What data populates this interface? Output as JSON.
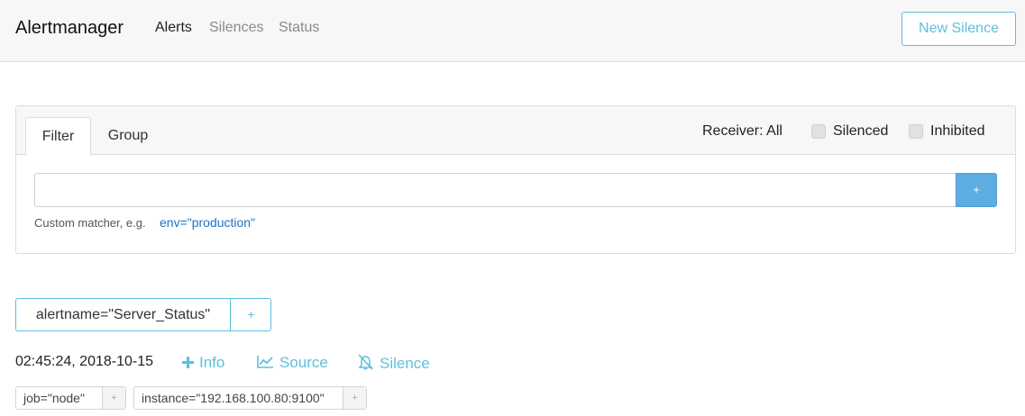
{
  "navbar": {
    "brand": "Alertmanager",
    "links": [
      {
        "label": "Alerts",
        "active": true
      },
      {
        "label": "Silences",
        "active": false
      },
      {
        "label": "Status",
        "active": false
      }
    ],
    "new_silence_label": "New Silence"
  },
  "filter_card": {
    "tabs": [
      {
        "label": "Filter",
        "active": true
      },
      {
        "label": "Group",
        "active": false
      }
    ],
    "receiver": "Receiver: All",
    "silenced_label": "Silenced",
    "inhibited_label": "Inhibited",
    "input_value": "",
    "add_button_label": "+",
    "hint": "Custom matcher, e.g.",
    "hint_example": "env=\"production\""
  },
  "alert_group": {
    "label": "alertname=\"Server_Status\"",
    "add_label": "+",
    "alert": {
      "time": "02:45:24, 2018-10-15",
      "actions": {
        "info": "Info",
        "source": "Source",
        "silence": "Silence"
      },
      "labels": [
        {
          "text": "job=\"node\"",
          "plus": "+"
        },
        {
          "text": "instance=\"192.168.100.80:9100\"",
          "plus": "+"
        }
      ]
    }
  },
  "colors": {
    "accent": "#5bc0de",
    "primary_button": "#5dade2",
    "link": "#1a73c6",
    "navbar_bg": "#f7f7f8"
  },
  "icons": {
    "info": "plus-icon",
    "source": "chart-line-icon",
    "silence": "bell-slash-icon"
  }
}
